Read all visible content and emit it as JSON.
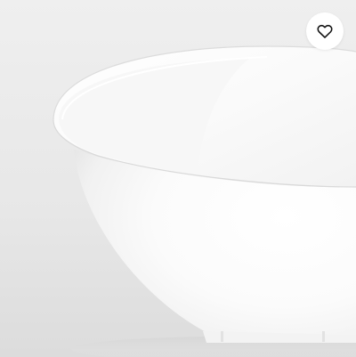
{
  "product_image": {
    "alt": "",
    "subject": "white bowl"
  },
  "favorite_button": {
    "icon": "heart-outline-icon",
    "aria_label": ""
  },
  "colors": {
    "background": "#e6e6e6",
    "bowl": "#ffffff",
    "button_bg": "#ffffff",
    "icon": "#111111"
  }
}
